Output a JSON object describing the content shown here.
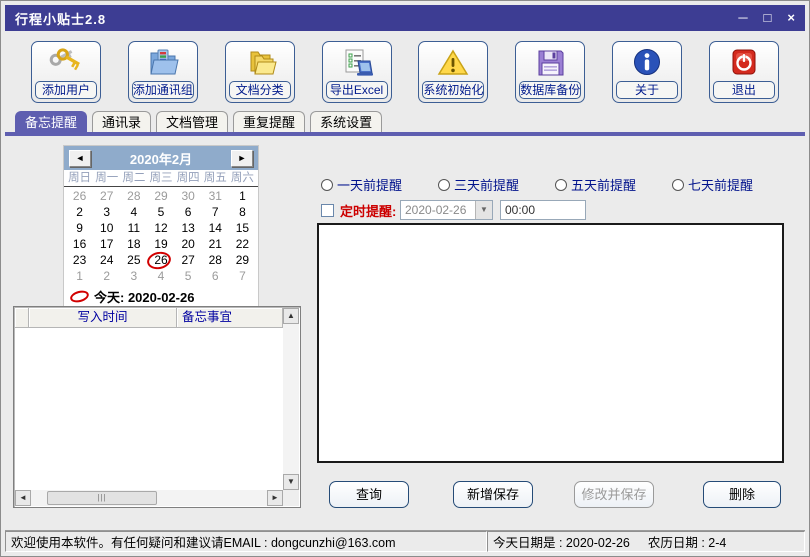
{
  "window": {
    "title": "行程小贴士2.8",
    "controls": {
      "minimize": "─",
      "maximize": "□",
      "close": "×"
    }
  },
  "colors": {
    "titlebar": "#3d3d93",
    "tab_active": "#5e5eb0",
    "calendar_header": "#8fabcb",
    "label_navy": "#00128c",
    "alert_red": "#cc0000",
    "exit_red": "#d42a1e"
  },
  "toolbar": {
    "items": [
      {
        "label": "添加用户",
        "icon": "keys-icon"
      },
      {
        "label": "添加通讯组",
        "icon": "contact-group-icon"
      },
      {
        "label": "文档分类",
        "icon": "folders-icon"
      },
      {
        "label": "导出Excel",
        "icon": "export-excel-icon"
      },
      {
        "label": "系统初始化",
        "icon": "warning-icon"
      },
      {
        "label": "数据库备份",
        "icon": "floppy-icon"
      },
      {
        "label": "关于",
        "icon": "info-icon"
      },
      {
        "label": "退出",
        "icon": "power-icon"
      }
    ]
  },
  "tabs": [
    {
      "label": "备忘提醒",
      "active": true
    },
    {
      "label": "通讯录",
      "active": false
    },
    {
      "label": "文档管理",
      "active": false
    },
    {
      "label": "重复提醒",
      "active": false
    },
    {
      "label": "系统设置",
      "active": false
    }
  ],
  "calendar": {
    "title": "2020年2月",
    "prev_icon": "◄",
    "next_icon": "►",
    "weekdays": [
      "周日",
      "周一",
      "周二",
      "周三",
      "周四",
      "周五",
      "周六"
    ],
    "days": [
      {
        "d": "26",
        "muted": true
      },
      {
        "d": "27",
        "muted": true
      },
      {
        "d": "28",
        "muted": true
      },
      {
        "d": "29",
        "muted": true
      },
      {
        "d": "30",
        "muted": true
      },
      {
        "d": "31",
        "muted": true
      },
      {
        "d": "1"
      },
      {
        "d": "2"
      },
      {
        "d": "3"
      },
      {
        "d": "4"
      },
      {
        "d": "5"
      },
      {
        "d": "6"
      },
      {
        "d": "7"
      },
      {
        "d": "8"
      },
      {
        "d": "9"
      },
      {
        "d": "10"
      },
      {
        "d": "11"
      },
      {
        "d": "12"
      },
      {
        "d": "13"
      },
      {
        "d": "14"
      },
      {
        "d": "15"
      },
      {
        "d": "16"
      },
      {
        "d": "17"
      },
      {
        "d": "18"
      },
      {
        "d": "19"
      },
      {
        "d": "20"
      },
      {
        "d": "21"
      },
      {
        "d": "22"
      },
      {
        "d": "23"
      },
      {
        "d": "24"
      },
      {
        "d": "25"
      },
      {
        "d": "26",
        "today": true
      },
      {
        "d": "27"
      },
      {
        "d": "28"
      },
      {
        "d": "29"
      },
      {
        "d": "1",
        "muted": true
      },
      {
        "d": "2",
        "muted": true
      },
      {
        "d": "3",
        "muted": true
      },
      {
        "d": "4",
        "muted": true
      },
      {
        "d": "5",
        "muted": true
      },
      {
        "d": "6",
        "muted": true
      },
      {
        "d": "7",
        "muted": true
      }
    ],
    "today_label": "今天: 2020-02-26"
  },
  "reminders": {
    "radios": [
      "一天前提醒",
      "三天前提醒",
      "五天前提醒",
      "七天前提醒"
    ],
    "timed_label": "定时提醒:",
    "date_value": "2020-02-26",
    "combo_arrow": "▼",
    "time_value": "00:00"
  },
  "table": {
    "headers": [
      "写入时间",
      "备忘事宜"
    ],
    "rows": [],
    "scroll": {
      "up": "▲",
      "down": "▼",
      "left": "◄",
      "right": "►",
      "grip": "|||"
    }
  },
  "actions": [
    {
      "label": "查询",
      "enabled": true
    },
    {
      "label": "新增保存",
      "enabled": true
    },
    {
      "label": "修改并保存",
      "enabled": false
    },
    {
      "label": "删除",
      "enabled": true
    }
  ],
  "statusbar": {
    "left": "欢迎使用本软件。有任何疑问和建议请EMAIL : dongcunzhi@163.com",
    "today": "今天日期是 : 2020-02-26",
    "lunar": "农历日期 : 2-4"
  }
}
